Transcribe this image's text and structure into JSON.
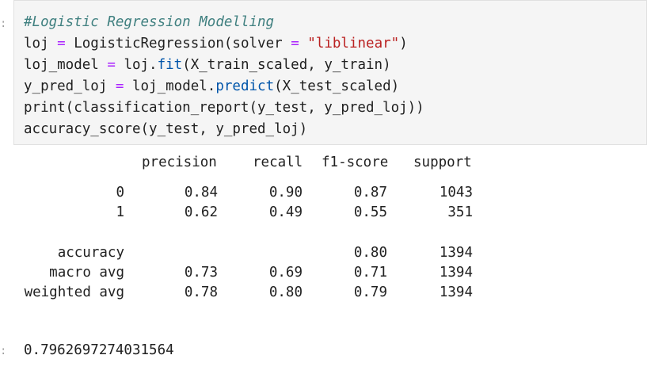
{
  "input_prompt": ":",
  "output_prompt": ":",
  "code_lines": [
    [
      {
        "t": "#Logistic Regression Modelling",
        "c": "comment"
      }
    ],
    [
      {
        "t": "loj "
      },
      {
        "t": "=",
        "c": "op"
      },
      {
        "t": " LogisticRegression(solver "
      },
      {
        "t": "=",
        "c": "op"
      },
      {
        "t": " "
      },
      {
        "t": "\"liblinear\"",
        "c": "str"
      },
      {
        "t": ")"
      }
    ],
    [
      {
        "t": "loj_model "
      },
      {
        "t": "=",
        "c": "op"
      },
      {
        "t": " loj."
      },
      {
        "t": "fit",
        "c": "attr"
      },
      {
        "t": "(X_train_scaled, y_train)"
      }
    ],
    [
      {
        "t": "y_pred_loj "
      },
      {
        "t": "=",
        "c": "op"
      },
      {
        "t": " loj_model."
      },
      {
        "t": "predict",
        "c": "attr"
      },
      {
        "t": "(X_test_scaled)"
      }
    ],
    [
      {
        "t": "print(classification_report(y_test, y_pred_loj))"
      }
    ],
    [
      {
        "t": "accuracy_score(y_test, y_pred_loj)"
      }
    ]
  ],
  "report": {
    "headers": [
      "precision",
      "recall",
      "f1-score",
      "support"
    ],
    "rows": [
      {
        "label": "0",
        "precision": "0.84",
        "recall": "0.90",
        "f1": "0.87",
        "support": "1043"
      },
      {
        "label": "1",
        "precision": "0.62",
        "recall": "0.49",
        "f1": "0.55",
        "support": "351"
      },
      {
        "label": "accuracy",
        "precision": "",
        "recall": "",
        "f1": "0.80",
        "support": "1394"
      },
      {
        "label": "macro avg",
        "precision": "0.73",
        "recall": "0.69",
        "f1": "0.71",
        "support": "1394"
      },
      {
        "label": "weighted avg",
        "precision": "0.78",
        "recall": "0.80",
        "f1": "0.79",
        "support": "1394"
      }
    ]
  },
  "result_value": "0.7962697274031564"
}
